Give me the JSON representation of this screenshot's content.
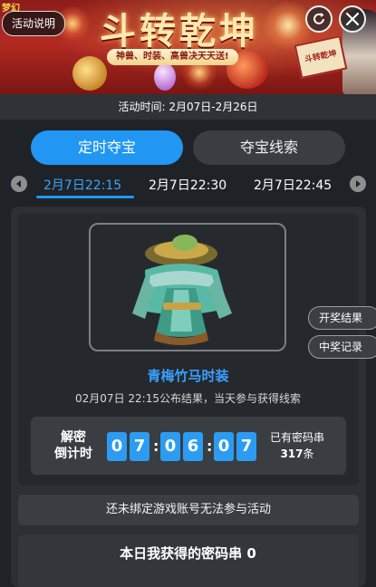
{
  "banner": {
    "title": "斗转乾坤",
    "subtitle": "神兽、时装、高兽决天天送!",
    "scroll_text": "斗转乾坤",
    "logo_text": "梦幻",
    "help_label": "活动说明",
    "refresh_icon": "refresh-icon",
    "close_icon": "close-icon"
  },
  "activity_time": "活动时间: 2月07日-2月26日",
  "tabs": [
    {
      "label": "定时夺宝",
      "active": true
    },
    {
      "label": "夺宝线索",
      "active": false
    }
  ],
  "time_slots": [
    {
      "label": "2月7日22:15",
      "active": true
    },
    {
      "label": "2月7日22:30",
      "active": false
    },
    {
      "label": "2月7日22:45",
      "active": false
    }
  ],
  "prize": {
    "name": "青梅竹马时装",
    "description": "02月07日 22:15公布结果，当天参与获得线索"
  },
  "countdown": {
    "label_line1": "解密",
    "label_line2": "倒计时",
    "digits": [
      "0",
      "7",
      "0",
      "6",
      "0",
      "7"
    ],
    "separator": ":",
    "code_label": "已有密码串",
    "code_count": "317",
    "code_unit": "条"
  },
  "side_buttons": {
    "results": "开奖结果",
    "winners": "中奖记录"
  },
  "bind_notice": "还未绑定游戏账号无法参与活动",
  "today_codes": "本日我获得的密码串 0",
  "colors": {
    "accent": "#2196f3",
    "prize_name": "#3aa0ff",
    "panel": "#2c2f33",
    "background": "#1f2327"
  }
}
